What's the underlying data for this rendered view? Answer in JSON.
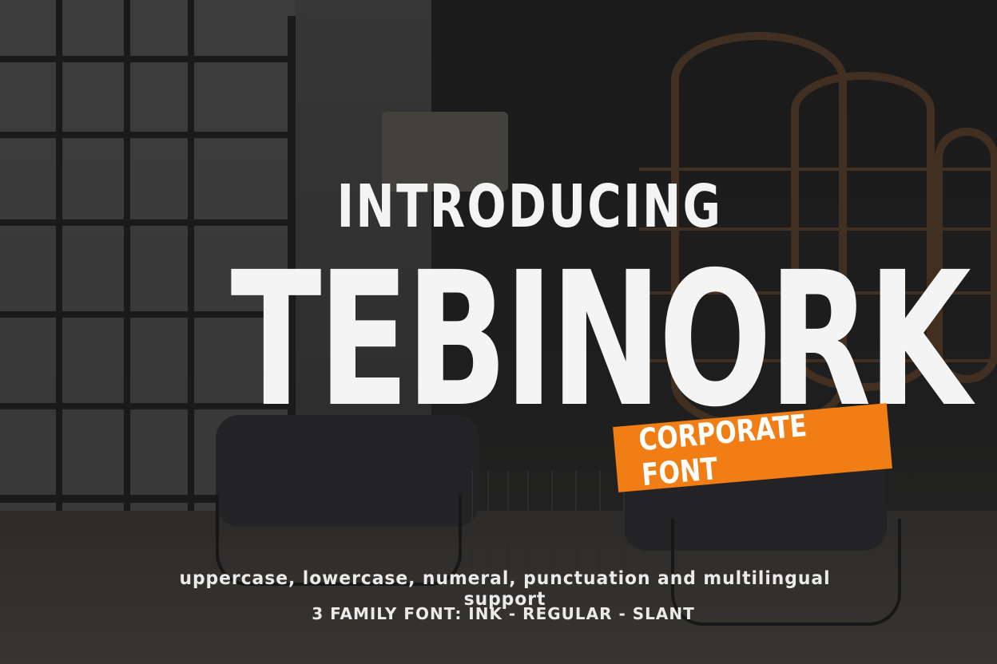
{
  "headline": {
    "intro": "INTRODUCING",
    "font_name": "TEBINORK"
  },
  "badge": {
    "label": "CORPORATE FONT",
    "color": "#f07e14"
  },
  "details": {
    "features": "uppercase, lowercase, numeral, punctuation and multilingual support",
    "families": "3 FAMILY FONT: INK - REGULAR - SLANT"
  }
}
